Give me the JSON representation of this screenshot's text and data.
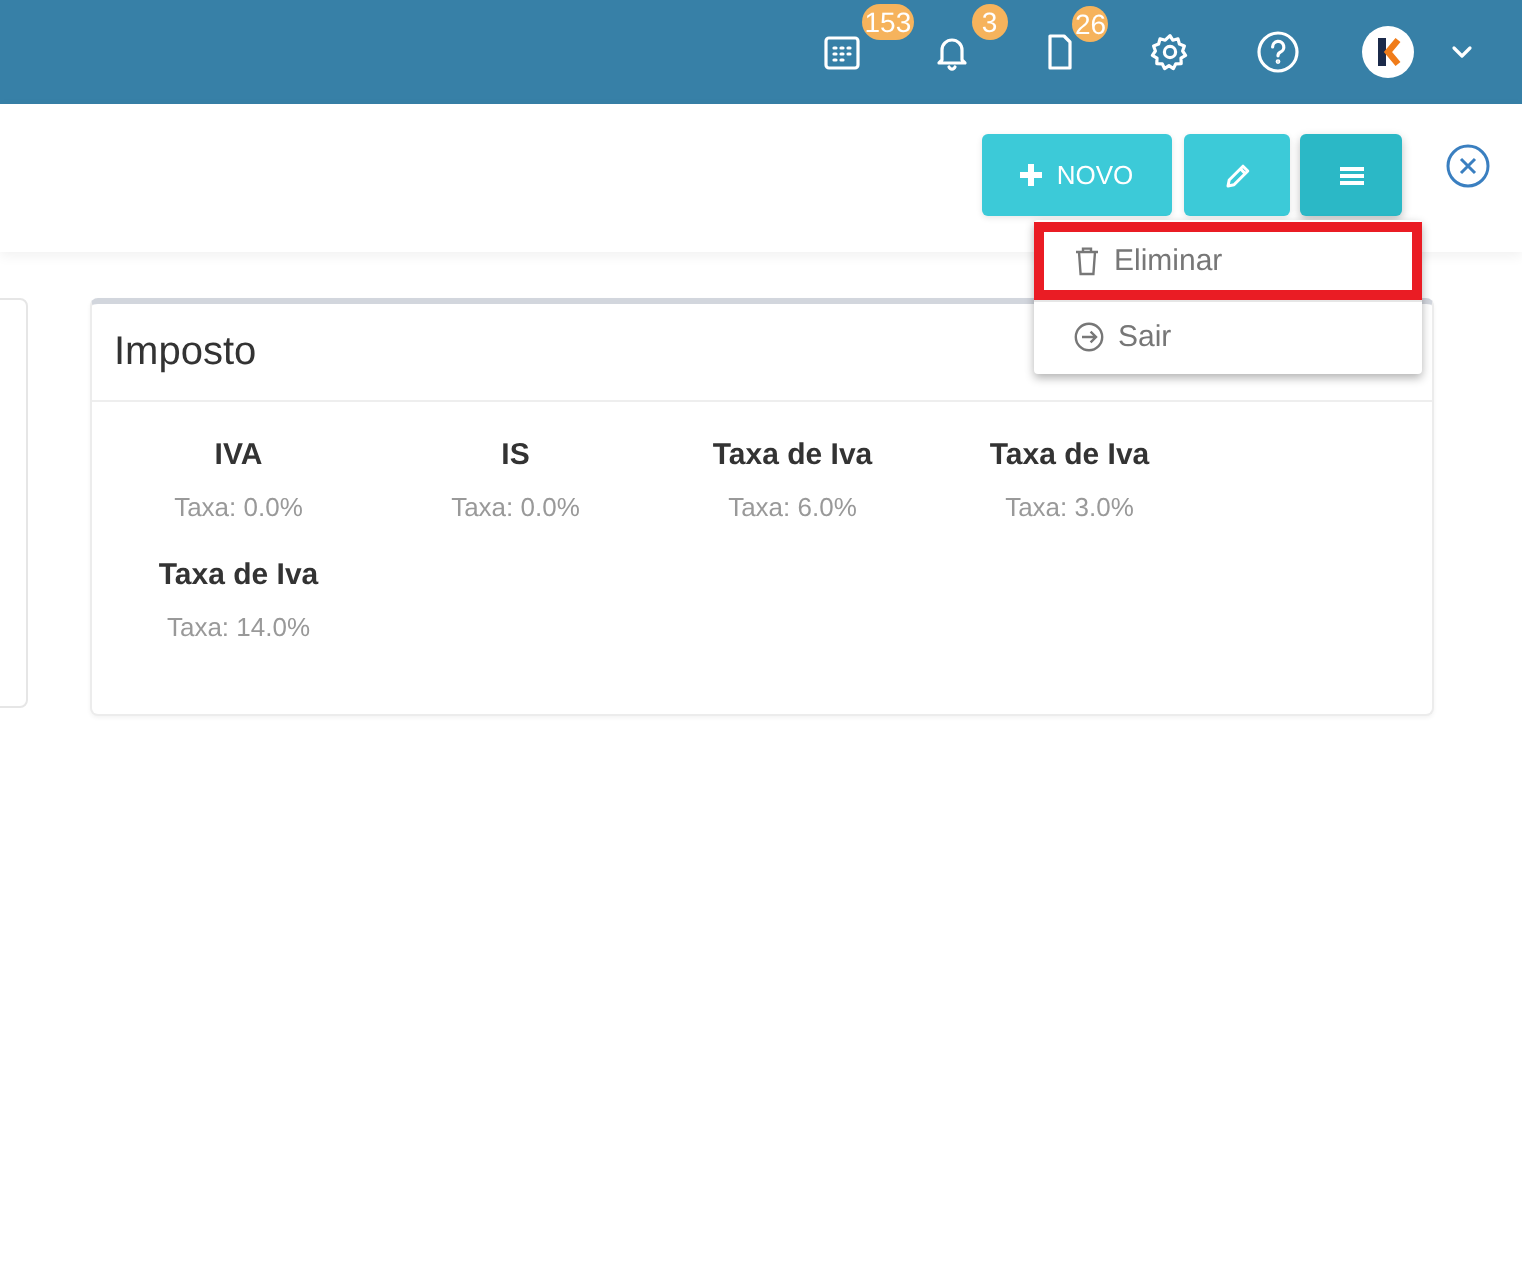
{
  "topbar": {
    "icons": [
      {
        "kind": "calendar",
        "badge": "153"
      },
      {
        "kind": "bell",
        "badge": "3"
      },
      {
        "kind": "document",
        "badge": "26"
      },
      {
        "kind": "settings"
      },
      {
        "kind": "help"
      },
      {
        "kind": "avatar"
      },
      {
        "kind": "chevron"
      }
    ]
  },
  "toolbar": {
    "buttons": [
      {
        "kind": "new",
        "label": "NOVO",
        "active": false
      },
      {
        "kind": "edit",
        "active": false
      },
      {
        "kind": "menu",
        "active": true
      }
    ],
    "menu": [
      {
        "kind": "delete",
        "label": "Eliminar",
        "highlighted": true
      },
      {
        "kind": "exit",
        "label": "Sair",
        "highlighted": false
      }
    ]
  },
  "card": {
    "title": "Imposto",
    "items": [
      {
        "name": "IVA",
        "rate": "Taxa: 0.0%"
      },
      {
        "name": "IS",
        "rate": "Taxa: 0.0%"
      },
      {
        "name": "Taxa de Iva",
        "rate": "Taxa: 6.0%"
      },
      {
        "name": "Taxa de Iva",
        "rate": "Taxa: 3.0%"
      },
      {
        "name": "Taxa de Iva",
        "rate": "Taxa: 14.0%"
      }
    ]
  }
}
